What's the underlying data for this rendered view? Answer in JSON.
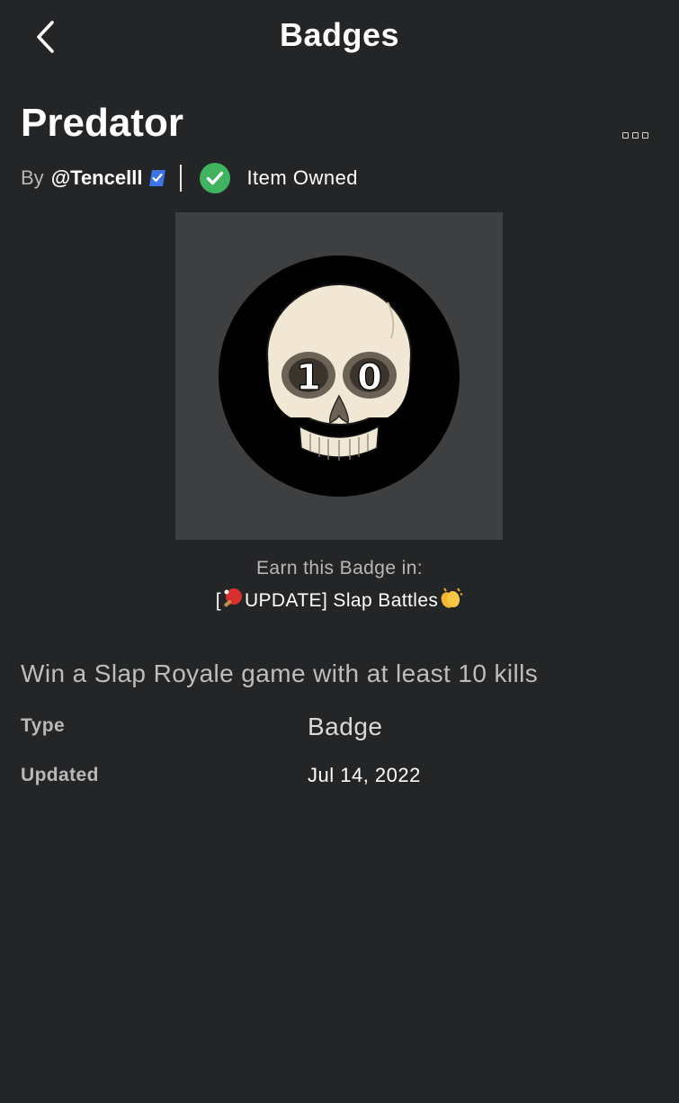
{
  "header": {
    "title": "Badges",
    "back_icon": "chevron-left-icon"
  },
  "item": {
    "title": "Predator",
    "by_prefix": "By",
    "creator": "@Tencelll",
    "creator_verified_icon": "verified-badge-icon",
    "owned_icon": "check-circle-icon",
    "owned_text": "Item Owned",
    "more_icon": "more-options-icon"
  },
  "badge_image": {
    "skull_text": "10",
    "colors": {
      "frame": "#3e3f41",
      "circle": "#000000",
      "skull": "#f1e7d4",
      "eye": "#6c6255"
    }
  },
  "earn": {
    "label": "Earn this Badge in:",
    "game_prefix": "[",
    "game_name": "UPDATE] Slap Battles",
    "game_emoji_start": "ping-pong-paddle-icon",
    "game_emoji_end": "clapping-hands-icon"
  },
  "details": {
    "description": "Win a Slap Royale game with at least 10 kills",
    "type_label": "Type",
    "type_value": "Badge",
    "updated_label": "Updated",
    "updated_value": "Jul 14, 2022"
  },
  "colors": {
    "background": "#232527",
    "owned_green": "#3fb35d",
    "verified_blue": "#3d73e6"
  }
}
